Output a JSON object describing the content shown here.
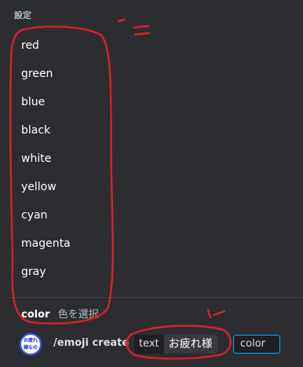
{
  "popup": {
    "header": "設定",
    "options": [
      "red",
      "green",
      "blue",
      "black",
      "white",
      "yellow",
      "cyan",
      "magenta",
      "gray"
    ]
  },
  "hint": {
    "name": "color",
    "description": "色を選択"
  },
  "composer": {
    "app_icon_text": "お疲れ様なの",
    "command": "/emoji create",
    "params": [
      {
        "name": "text",
        "value": "お疲れ様"
      },
      {
        "name": "color",
        "value": ""
      }
    ]
  },
  "colors": {
    "annotation": "#d4202a",
    "focus_border": "#00a8fc"
  }
}
